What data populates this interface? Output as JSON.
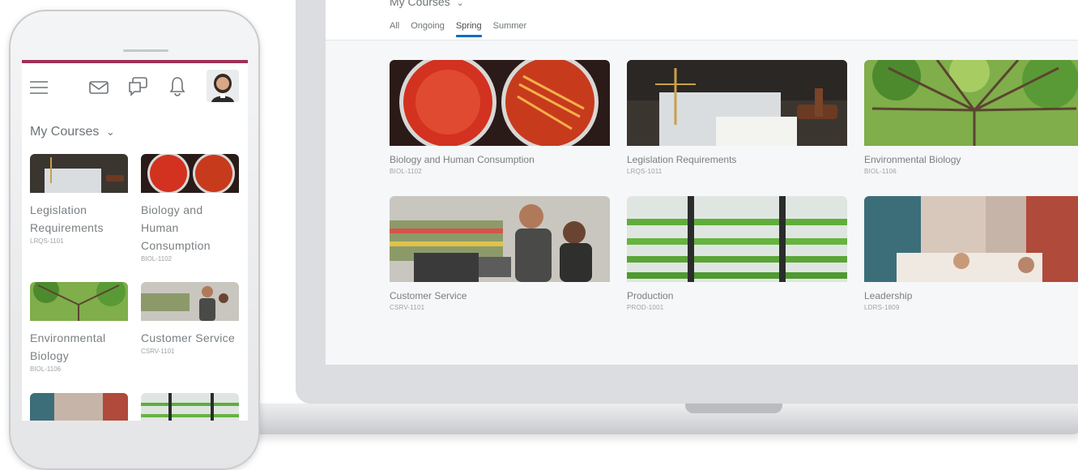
{
  "laptop": {
    "header": {
      "title": "My Courses",
      "tabs": [
        {
          "label": "All",
          "active": false
        },
        {
          "label": "Ongoing",
          "active": false
        },
        {
          "label": "Spring",
          "active": true
        },
        {
          "label": "Summer",
          "active": false
        }
      ]
    },
    "courses": [
      {
        "name": "Biology and Human Consumption",
        "code": "BIOL-1102"
      },
      {
        "name": "Legislation Requirements",
        "code": "LRQS-1011"
      },
      {
        "name": "Environmental Biology",
        "code": "BIOL-1106"
      },
      {
        "name": "Customer Service",
        "code": "CSRV-1101"
      },
      {
        "name": "Production",
        "code": "PROD-1001"
      },
      {
        "name": "Leadership",
        "code": "LDRS-1809"
      }
    ]
  },
  "phone": {
    "title": "My Courses",
    "icons": [
      "menu-icon",
      "mail-icon",
      "chat-icon",
      "bell-icon",
      "avatar"
    ],
    "courses": [
      {
        "name": "Legislation Requirements",
        "code": "LRQS-1101"
      },
      {
        "name": "Biology and Human Consumption",
        "code": "BIOL-1102"
      },
      {
        "name": "Environmental Biology",
        "code": "BIOL-1106"
      },
      {
        "name": "Customer Service",
        "code": "CSRV-1101"
      }
    ]
  },
  "colors": {
    "accent_tab": "#006fbf",
    "phone_brand_bar": "#a0305a",
    "text": "#6e7477"
  }
}
